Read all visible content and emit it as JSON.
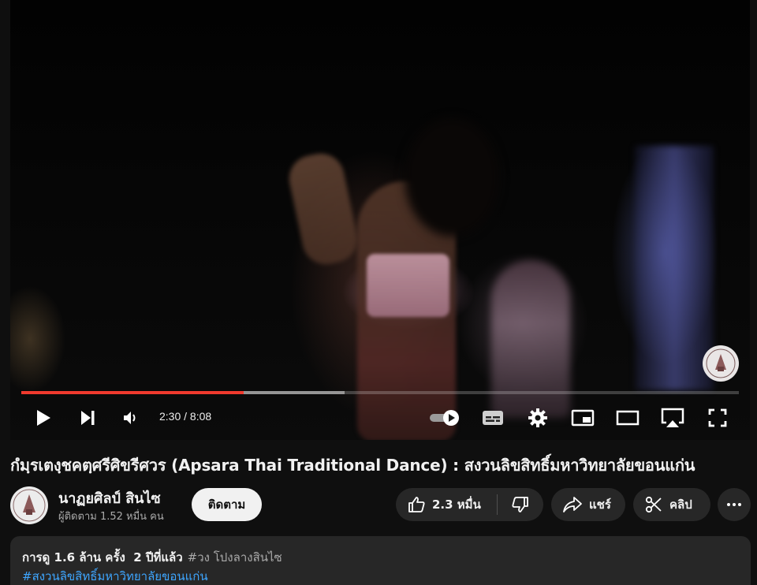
{
  "player": {
    "current_time": "2:30",
    "duration": "8:08",
    "time_separator": " / ",
    "progress_fraction": 0.31,
    "buffer_fraction": 0.45,
    "accent_color": "#f03a2e"
  },
  "video": {
    "title": "กํมฺรเตงฺชคตฺศรีศิขรีศวร (Apsara Thai Traditional Dance) : สงวนลิขสิทธิ์มหาวิทยาลัยขอนแก่น"
  },
  "channel": {
    "name": "นาฏยศิลป์ สินไซ",
    "subscribers": "ผู้ติดตาม 1.52 หมื่น คน",
    "subscribe_label": "ติดตาม"
  },
  "actions": {
    "like_count": "2.3 หมื่น",
    "share_label": "แชร์",
    "clip_label": "คลิป"
  },
  "description": {
    "views": "การดู 1.6 ล้าน ครั้ง",
    "age": "2 ปีที่แล้ว",
    "tag": "#วง โปงลางสินไซ",
    "hashtag": "#สงวนลิขสิทธิ์มหาวิทยาลัยขอนแก่น"
  },
  "icons": [
    "play-icon",
    "next-icon",
    "volume-icon",
    "autoplay-toggle-icon",
    "subtitles-icon",
    "settings-icon",
    "miniplayer-icon",
    "theater-icon",
    "airplay-icon",
    "fullscreen-icon",
    "like-icon",
    "dislike-icon",
    "share-icon",
    "clip-icon",
    "more-icon"
  ]
}
